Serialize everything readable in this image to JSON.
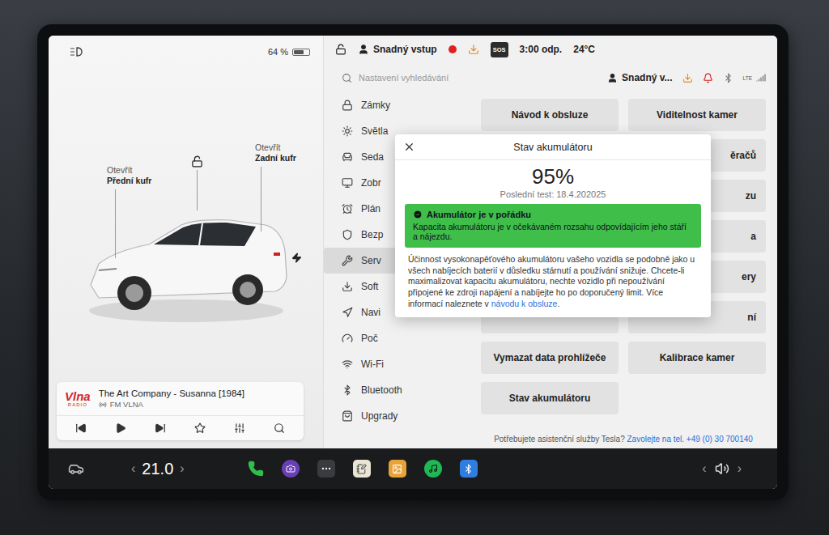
{
  "status_bar": {
    "battery": "64 %",
    "battery_level": 0.64,
    "profile": "Snadný vstup",
    "recording": true,
    "sos": "SOS",
    "time": "3:00 odp.",
    "temperature": "24°C"
  },
  "car": {
    "locked": false,
    "charging": true,
    "frunk": {
      "action": "Otevřít",
      "label": "Přední kufr"
    },
    "trunk": {
      "action": "Otevřít",
      "label": "Zadní kufr"
    }
  },
  "media": {
    "logo": "Vlna",
    "logo_sub": "RADIO",
    "title": "The Art Company - Susanna [1984]",
    "source": "FM VLNA",
    "playing": false
  },
  "search": {
    "placeholder": "Nastavení vyhledávání"
  },
  "profile": {
    "name": "Snadný v...",
    "network": "LTE"
  },
  "sidebar": {
    "items": [
      {
        "label": "Zámky",
        "selected": false
      },
      {
        "label": "Světla",
        "selected": false
      },
      {
        "label": "Seda",
        "selected": false
      },
      {
        "label": "Zobr",
        "selected": false
      },
      {
        "label": "Plán",
        "selected": false
      },
      {
        "label": "Bezp",
        "selected": false
      },
      {
        "label": "Serv",
        "selected": true
      },
      {
        "label": "Soft",
        "selected": false
      },
      {
        "label": "Navi",
        "selected": false
      },
      {
        "label": "Poč",
        "selected": false
      },
      {
        "label": "Wi-Fi",
        "selected": false
      },
      {
        "label": "Bluetooth",
        "selected": false
      },
      {
        "label": "Upgrady",
        "selected": false
      }
    ]
  },
  "grid": {
    "rows": [
      {
        "cells": [
          {
            "label": "Návod k obsluze",
            "kind": "full"
          },
          {
            "label": "Viditelnost kamer",
            "kind": "full"
          }
        ]
      },
      {
        "cells": [
          {
            "kind": "covered"
          },
          {
            "label": "ěračů",
            "kind": "cut"
          }
        ]
      },
      {
        "cells": [
          {
            "kind": "covered"
          },
          {
            "label": "zu",
            "kind": "cut"
          }
        ]
      },
      {
        "cells": [
          {
            "kind": "covered"
          },
          {
            "label": "a",
            "kind": "cut"
          }
        ]
      },
      {
        "cells": [
          {
            "kind": "covered"
          },
          {
            "label": "ery",
            "kind": "cut"
          }
        ]
      },
      {
        "cells": [
          {
            "kind": "covered"
          },
          {
            "label": "ní",
            "kind": "cut"
          }
        ]
      },
      {
        "cells": [
          {
            "label": "Vymazat data prohlížeče",
            "kind": "full"
          },
          {
            "label": "Kalibrace kamer",
            "kind": "full"
          }
        ]
      },
      {
        "cells": [
          {
            "label": "Stav akumulátoru",
            "kind": "full"
          },
          {
            "kind": "empty"
          }
        ]
      }
    ]
  },
  "footer": {
    "text": "Potřebujete asistenční služby Tesla?",
    "link": "Zavolejte na tel. +49 (0) 30 700140"
  },
  "dialog": {
    "title": "Stav akumulátoru",
    "value": "95%",
    "last_test": "Poslední test: 18.4.202025",
    "status": {
      "title": "Akumulátor je v pořádku",
      "text": "Kapacita akumulátoru je v očekávaném rozsahu odpovídajícím jeho stáří a nájezdu."
    },
    "body": "Účinnost vysokonapěťového akumulátoru vašeho vozidla se podobně jako u všech nabíjecích baterií v důsledku stárnutí a používání snižuje. Chcete-li maximalizovat kapacitu akumulátoru, nechte vozidlo při nepoužívání připojené ke zdroji napájení a nabíjejte ho po doporučený limit. Více informací naleznete v",
    "link": "návodu k obsluze",
    "end": "."
  },
  "bottom_bar": {
    "temperature": "21.0",
    "temp_down": "‹",
    "temp_up": "›",
    "volume_down": "‹",
    "volume_up": "›"
  }
}
